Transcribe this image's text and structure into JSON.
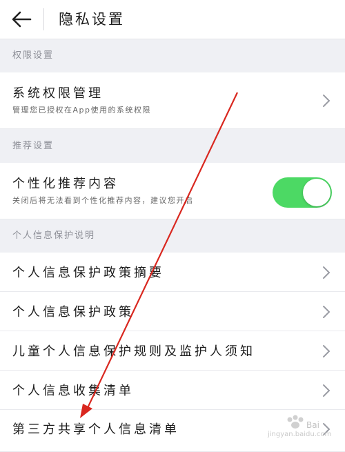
{
  "header": {
    "title": "隐私设置",
    "back_icon": "arrow-left-icon"
  },
  "sections": {
    "permissions": "权限设置",
    "recommendations": "推荐设置",
    "privacy_info": "个人信息保护说明"
  },
  "rows": {
    "system_permissions": {
      "title": "系统权限管理",
      "subtitle": "管理您已授权在App使用的系统权限"
    },
    "personalized": {
      "title": "个性化推荐内容",
      "subtitle": "关闭后将无法看到个性化推荐内容，建议您开启",
      "toggle_on": true
    },
    "policy_summary": {
      "title": "个人信息保护政策摘要"
    },
    "policy": {
      "title": "个人信息保护政策"
    },
    "children_rules": {
      "title": "儿童个人信息保护规则及监护人须知"
    },
    "collection_list": {
      "title": "个人信息收集清单"
    },
    "third_party_list": {
      "title": "第三方共享个人信息清单"
    }
  },
  "colors": {
    "toggle_on": "#4cd964",
    "annotation_arrow": "#d9271f",
    "section_bg": "#eff0f4"
  },
  "watermark": {
    "text": "jingyan.baidu.com"
  }
}
